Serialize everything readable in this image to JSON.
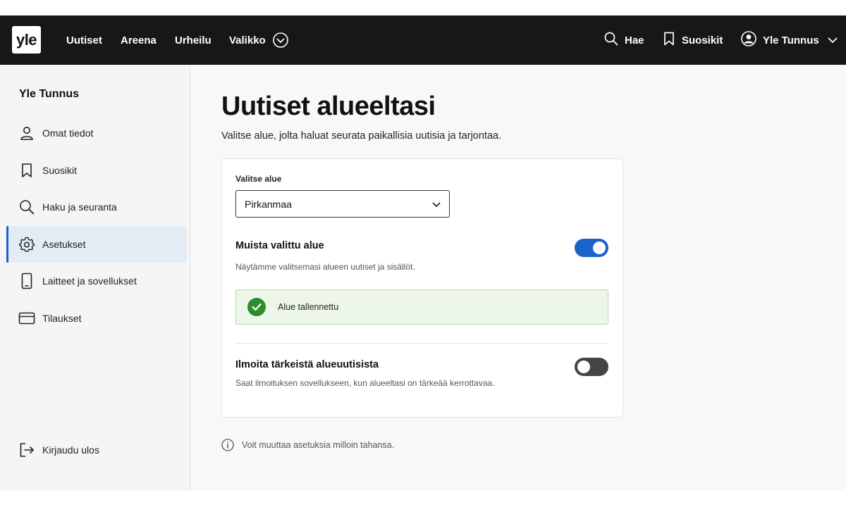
{
  "header": {
    "logo_text": "yle",
    "nav": [
      "Uutiset",
      "Areena",
      "Urheilu",
      "Valikko"
    ],
    "search_label": "Hae",
    "favorites_label": "Suosikit",
    "account_label": "Yle Tunnus"
  },
  "sidebar": {
    "title": "Yle Tunnus",
    "items": [
      {
        "label": "Omat tiedot",
        "icon": "person-icon"
      },
      {
        "label": "Suosikit",
        "icon": "bookmark-icon"
      },
      {
        "label": "Haku ja seuranta",
        "icon": "search-icon"
      },
      {
        "label": "Asetukset",
        "icon": "gear-icon",
        "active": true
      },
      {
        "label": "Laitteet ja sovellukset",
        "icon": "device-icon"
      },
      {
        "label": "Tilaukset",
        "icon": "card-icon"
      }
    ],
    "logout_label": "Kirjaudu ulos"
  },
  "main": {
    "title": "Uutiset alueeltasi",
    "description": "Valitse alue, jolta haluat seurata paikallisia uutisia ja tarjontaa.",
    "region_label": "Valitse alue",
    "region_value": "Pirkanmaa",
    "remember": {
      "title": "Muista valittu alue",
      "description": "Näytämme valitsemasi alueen uutiset ja sisällöt.",
      "enabled": true
    },
    "success_message": "Alue tallennettu",
    "notify": {
      "title": "Ilmoita tärkeistä alueuutisista",
      "description": "Saat ilmoituksen sovellukseen, kun alueeltasi on tärkeää kerrottavaa.",
      "enabled": false
    },
    "info_text": "Voit muuttaa asetuksia milloin tahansa."
  },
  "colors": {
    "header_bg": "#171717",
    "accent": "#1a63c8",
    "success_bg": "#edf7e9",
    "success_icon": "#2e8b2e"
  }
}
